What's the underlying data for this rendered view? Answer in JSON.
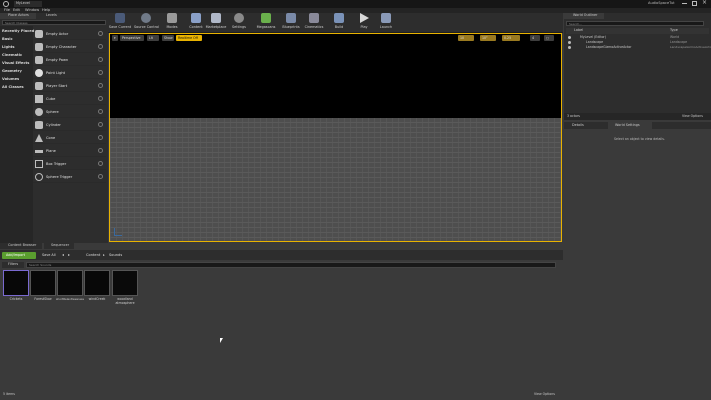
{
  "window": {
    "title_tab": "MyLevel",
    "app_name": "AudioSpaceTut"
  },
  "menu": [
    "File",
    "Edit",
    "Window",
    "Help"
  ],
  "left_panel": {
    "tabs": [
      "Place Actors",
      "Levels"
    ],
    "search_placeholder": "Search Classes",
    "categories": [
      "Recently Placed",
      "Basic",
      "Lights",
      "Cinematic",
      "Visual Effects",
      "Geometry",
      "Volumes",
      "All Classes"
    ],
    "actors": [
      "Empty Actor",
      "Empty Character",
      "Empty Pawn",
      "Point Light",
      "Player Start",
      "Cube",
      "Sphere",
      "Cylinder",
      "Cone",
      "Plane",
      "Box Trigger",
      "Sphere Trigger"
    ]
  },
  "toolbar": [
    "Save Current",
    "Source Control",
    "Modes",
    "Content",
    "Marketplace",
    "Settings",
    "Blueprints",
    "Cinematics",
    "Build",
    "Play",
    "Launch"
  ],
  "toolbar_extra": "Megascans",
  "viewport": {
    "perspective": "Perspective",
    "lit": "Lit",
    "show": "Show",
    "badge": "Realtime Off",
    "snap_values": [
      "10",
      "10°",
      "0.25",
      "4"
    ]
  },
  "outliner": {
    "title": "World Outliner",
    "search_placeholder": "Search...",
    "col_label": "Label",
    "col_type": "Type",
    "rows": [
      {
        "label": "MyLevel (Editor)",
        "type": "World"
      },
      {
        "label": "Landscape",
        "type": "Landscape"
      },
      {
        "label": "LandscapeGizmoActiveActor",
        "type": "LandscapeGizmoActiveActor"
      }
    ],
    "status": "3 actors",
    "view_options": "View Options"
  },
  "details": {
    "tab1": "Details",
    "tab2": "World Settings",
    "empty_msg": "Select an object to view details."
  },
  "content_browser": {
    "tabs": [
      "Content Browser",
      "Sequencer"
    ],
    "add_new": "Add/Import",
    "save_all": "Save All",
    "path": [
      "Content",
      "Sounds"
    ],
    "filters": "Filters",
    "search_placeholder": "Search Sounds",
    "assets": [
      "Crickets",
      "ForestSlow",
      "shortRelentlessness",
      "windCreek",
      "woodland atmosphere"
    ],
    "status": "5 items",
    "view_options": "View Options"
  },
  "colors": {
    "accent": "#e8b200",
    "add_green": "#5a9e2f",
    "megascans": "#6ab04c"
  }
}
